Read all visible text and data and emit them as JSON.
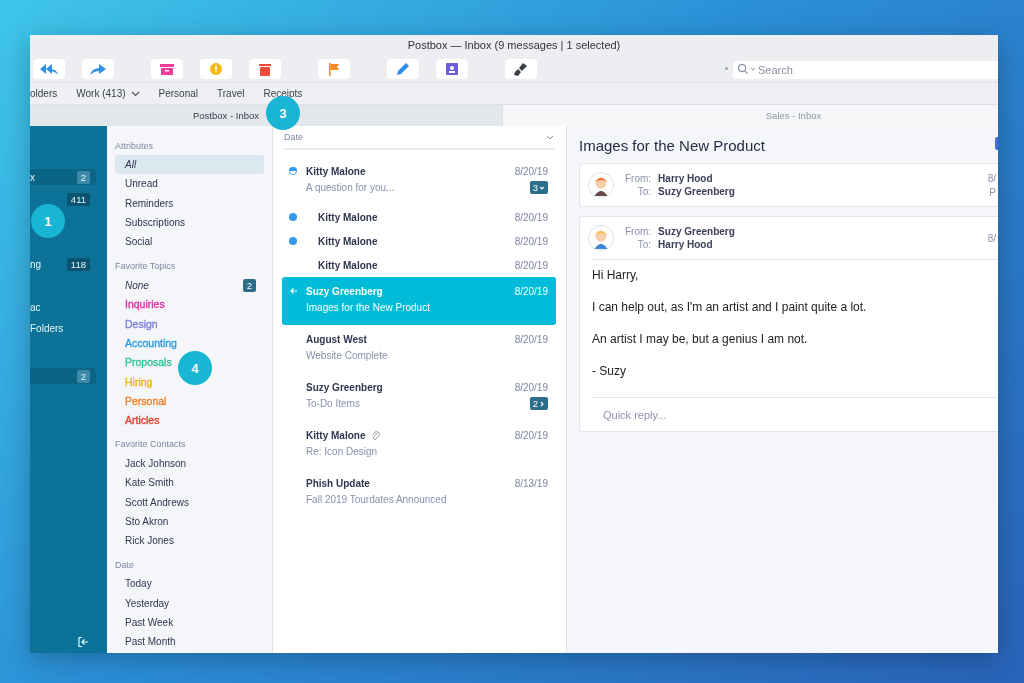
{
  "window": {
    "title": "Postbox — Inbox (9 messages | 1 selected)"
  },
  "search": {
    "placeholder": "Search"
  },
  "favorites_bar": [
    {
      "label": "olders"
    },
    {
      "label": "Work (413)",
      "menu": true
    },
    {
      "label": "Personal"
    },
    {
      "label": "Travel"
    },
    {
      "label": "Receipts"
    }
  ],
  "tabs": [
    {
      "label": "Postbox - Inbox",
      "selected": true
    },
    {
      "label": "Sales - Inbox",
      "selected": false
    }
  ],
  "folders": [
    {
      "label": "x",
      "count": "2",
      "selected": true
    },
    {
      "count": "411",
      "selected": false
    },
    {
      "label": "ng",
      "count": "118",
      "selected": false
    },
    {
      "label": "ac",
      "selected": false
    },
    {
      "label": "Folders",
      "selected": false
    },
    {
      "count": "2",
      "selected": true
    }
  ],
  "filters": [
    {
      "title": "Attributes",
      "items": [
        {
          "label": "All",
          "kind": "any",
          "selected": true
        },
        {
          "label": "Unread",
          "kind": "value",
          "selected": false
        },
        {
          "label": "Reminders",
          "kind": "value",
          "selected": false
        },
        {
          "label": "Subscriptions",
          "kind": "value",
          "selected": false
        },
        {
          "label": "Social",
          "kind": "value",
          "selected": false
        }
      ]
    },
    {
      "title": "Favorite Topics",
      "items": [
        {
          "label": "None",
          "kind": "any",
          "selected": false,
          "count": "2"
        },
        {
          "label": "Inquiries",
          "kind": "topic",
          "color": "#e62ea6",
          "selected": false
        },
        {
          "label": "Design",
          "kind": "topic",
          "color": "#7b7fd9",
          "selected": false
        },
        {
          "label": "Accounting",
          "kind": "topic",
          "color": "#2b9be0",
          "selected": false
        },
        {
          "label": "Proposals",
          "kind": "topic",
          "color": "#2fbf9a",
          "selected": false
        },
        {
          "label": "Hiring",
          "kind": "topic",
          "color": "#f2b01e",
          "selected": false
        },
        {
          "label": "Personal",
          "kind": "topic",
          "color": "#f07f24",
          "selected": false
        },
        {
          "label": "Articles",
          "kind": "topic",
          "color": "#eb3b2f",
          "selected": false
        }
      ]
    },
    {
      "title": "Favorite Contacts",
      "items": [
        {
          "label": "Jack Johnson",
          "kind": "value",
          "selected": false
        },
        {
          "label": "Kate Smith",
          "kind": "value",
          "selected": false
        },
        {
          "label": "Scott Andrews",
          "kind": "value",
          "selected": false
        },
        {
          "label": "Sto Akron",
          "kind": "value",
          "selected": false
        },
        {
          "label": "Rick Jones",
          "kind": "value",
          "selected": false
        }
      ]
    },
    {
      "title": "Date",
      "items": [
        {
          "label": "Today",
          "kind": "value",
          "selected": false
        },
        {
          "label": "Yesterday",
          "kind": "value",
          "selected": false
        },
        {
          "label": "Past Week",
          "kind": "value",
          "selected": false
        },
        {
          "label": "Past Month",
          "kind": "value",
          "selected": false
        }
      ]
    }
  ],
  "message_list": {
    "sort_label": "Date",
    "messages": [
      {
        "sender": "Kitty Malone",
        "subject": "A question for you...",
        "date": "8/20/19",
        "unread": false,
        "thread_unread": true,
        "selected": false,
        "thread_count": "3",
        "expanded": true,
        "children": [
          {
            "sender": "Kitty Malone",
            "date": "8/20/19",
            "unread": true,
            "selected": false
          },
          {
            "sender": "Kitty Malone",
            "date": "8/20/19",
            "unread": true,
            "selected": false
          },
          {
            "sender": "Kitty Malone",
            "date": "8/20/19",
            "unread": false,
            "selected": false
          }
        ]
      },
      {
        "sender": "Suzy Greenberg",
        "subject": "Images for the New Product",
        "date": "8/20/19",
        "unread": false,
        "selected": true,
        "replied": true
      },
      {
        "sender": "August West",
        "subject": "Website Complete",
        "date": "8/20/19",
        "unread": false,
        "selected": false
      },
      {
        "sender": "Suzy Greenberg",
        "subject": "To-Do Items",
        "date": "8/20/19",
        "unread": false,
        "selected": false,
        "thread_count": "2",
        "expanded": false
      },
      {
        "sender": "Kitty Malone",
        "subject": "Re: Icon Design",
        "date": "8/20/19",
        "unread": false,
        "selected": false,
        "attachment": true
      },
      {
        "sender": "Phish Update",
        "subject": "Fall 2019 Tourdates Announced",
        "date": "8/13/19",
        "unread": false,
        "selected": false
      }
    ]
  },
  "reading_pane": {
    "subject": "Images for the New Product",
    "messages": [
      {
        "from_label": "From:",
        "from": "Harry Hood",
        "to_label": "To:",
        "to": "Suzy Greenberg",
        "date": "8/",
        "extra": "P"
      },
      {
        "from_label": "From:",
        "from": "Suzy Greenberg",
        "to_label": "To:",
        "to": "Harry Hood",
        "date": "8/",
        "body": [
          "Hi Harry,",
          "I can help out, as I'm an artist and I paint quite a lot.",
          "An artist I may be, but a genius I am not.",
          "- Suzy"
        ],
        "quick_reply": {
          "placeholder": "Quick reply..."
        }
      }
    ]
  },
  "callouts": [
    {
      "label": "1"
    },
    {
      "label": "3"
    },
    {
      "label": "4"
    }
  ]
}
